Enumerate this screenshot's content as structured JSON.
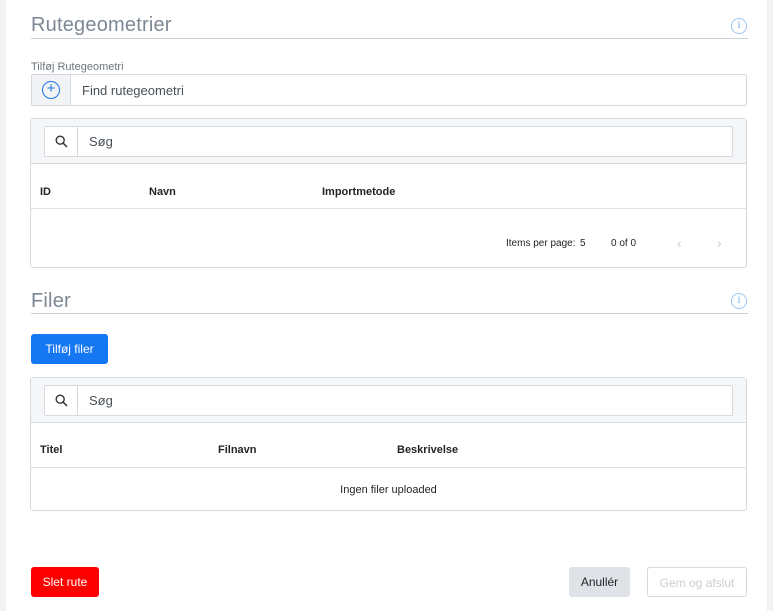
{
  "routes": {
    "title": "Rutegeometrier",
    "add_label": "Tilføj Rutegeometri",
    "find_placeholder": "Find rutegeometri",
    "search_placeholder": "Søg",
    "columns": [
      "ID",
      "Navn",
      "Importmetode"
    ],
    "pager": {
      "items_per_page_label": "Items per page:",
      "items_per_page_value": "5",
      "range": "0 of 0",
      "prev_icon": "chevron-left-icon",
      "next_icon": "chevron-right-icon"
    }
  },
  "files": {
    "title": "Filer",
    "add_button": "Tilføj filer",
    "search_placeholder": "Søg",
    "columns": [
      "Titel",
      "Filnavn",
      "Beskrivelse"
    ],
    "empty_text": "Ingen filer uploaded"
  },
  "footer": {
    "delete_button": "Slet rute",
    "cancel_button": "Anullér",
    "save_button": "Gem og afslut"
  },
  "colors": {
    "primary": "#1677f2",
    "danger": "#ff0000",
    "section_title": "#7d8895"
  },
  "icons": {
    "info": "info-icon",
    "add": "plus-circle-icon",
    "search": "search-icon"
  }
}
